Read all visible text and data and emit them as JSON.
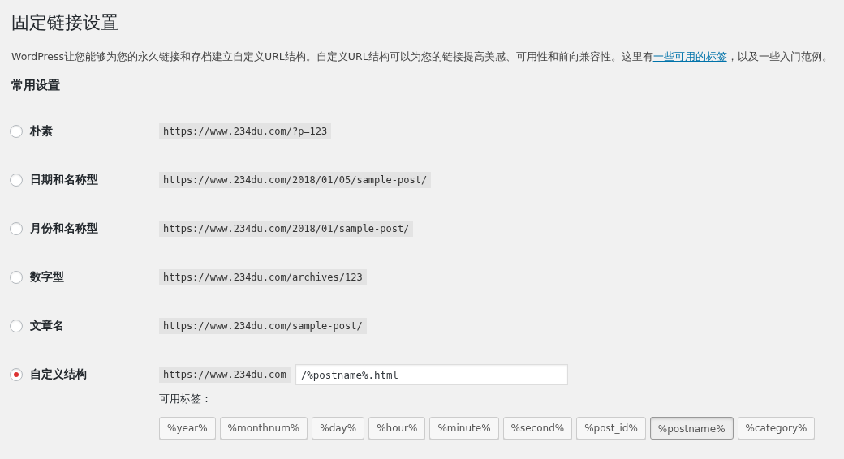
{
  "page": {
    "title": "固定链接设置"
  },
  "description": {
    "before": "WordPress让您能够为您的永久链接和存档建立自定义URL结构。自定义URL结构可以为您的链接提高美感、可用性和前向兼容性。这里有",
    "link": "一些可用的标签",
    "after": "，以及一些入门范例。"
  },
  "section": {
    "title": "常用设置"
  },
  "options": [
    {
      "label": "朴素",
      "example": "https://www.234du.com/?p=123",
      "selected": false
    },
    {
      "label": "日期和名称型",
      "example": "https://www.234du.com/2018/01/05/sample-post/",
      "selected": false
    },
    {
      "label": "月份和名称型",
      "example": "https://www.234du.com/2018/01/sample-post/",
      "selected": false
    },
    {
      "label": "数字型",
      "example": "https://www.234du.com/archives/123",
      "selected": false
    },
    {
      "label": "文章名",
      "example": "https://www.234du.com/sample-post/",
      "selected": false
    },
    {
      "label": "自定义结构",
      "example": "https://www.234du.com",
      "selected": true,
      "kind": "custom",
      "value": "/%postname%.html",
      "tags_label": "可用标签：",
      "tags": [
        {
          "label": "%year%",
          "selected": false
        },
        {
          "label": "%monthnum%",
          "selected": false
        },
        {
          "label": "%day%",
          "selected": false
        },
        {
          "label": "%hour%",
          "selected": false
        },
        {
          "label": "%minute%",
          "selected": false
        },
        {
          "label": "%second%",
          "selected": false
        },
        {
          "label": "%post_id%",
          "selected": false
        },
        {
          "label": "%postname%",
          "selected": true
        },
        {
          "label": "%category%",
          "selected": false
        }
      ]
    }
  ]
}
